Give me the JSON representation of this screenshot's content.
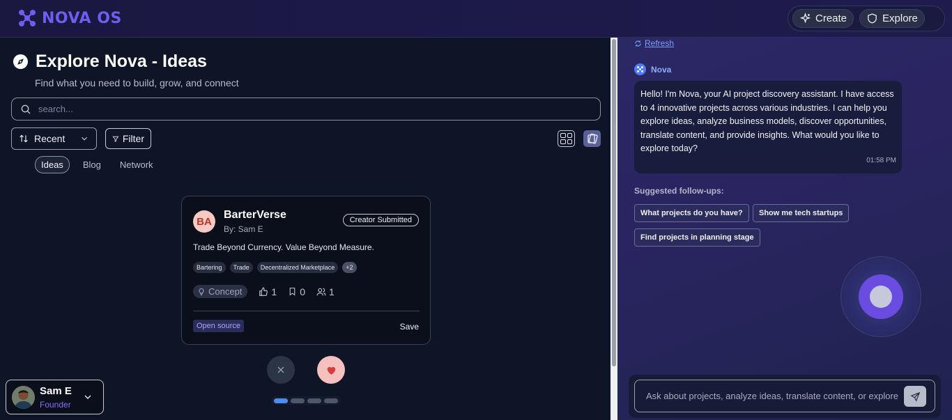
{
  "app": {
    "name": "NOVA OS"
  },
  "header": {
    "create_label": "Create",
    "explore_label": "Explore"
  },
  "page": {
    "title": "Explore Nova - Ideas",
    "subtitle": "Find what you need to build, grow, and connect",
    "search_placeholder": "search...",
    "sort_label": "Recent",
    "filter_label": "Filter",
    "tabs": [
      {
        "label": "Ideas",
        "active": true
      },
      {
        "label": "Blog",
        "active": false
      },
      {
        "label": "Network",
        "active": false
      }
    ]
  },
  "card": {
    "initials": "BA",
    "title": "BarterVerse",
    "author": "By: Sam E",
    "badge": "Creator Submitted",
    "description": "Trade Beyond Currency. Value Beyond Measure.",
    "tags": [
      "Bartering",
      "Trade",
      "Decentralized Marketplace"
    ],
    "more_tags": "+2",
    "stage": "Concept",
    "likes": "1",
    "bookmarks": "0",
    "members": "1",
    "license": "Open source",
    "save_label": "Save"
  },
  "carousel": {
    "total": 4,
    "active_index": 0
  },
  "user": {
    "name": "Sam E",
    "role": "Founder"
  },
  "chat": {
    "refresh_label": "Refresh",
    "assistant_name": "Nova",
    "message": "Hello! I'm Nova, your AI project discovery assistant. I have access to 4 innovative projects across various industries. I can help you explore ideas, analyze business models, discover opportunities, translate content, and provide insights. What would you like to explore today?",
    "message_time": "01:58 PM",
    "followups_label": "Suggested follow-ups:",
    "followups": [
      "What projects do you have?",
      "Show me tech startups",
      "Find projects in planning stage"
    ],
    "input_placeholder": "Ask about projects, analyze ideas, translate content, or explore"
  },
  "colors": {
    "accent": "#6d5ef0",
    "link": "#7aa0f8",
    "like": "#f5c0bd"
  }
}
